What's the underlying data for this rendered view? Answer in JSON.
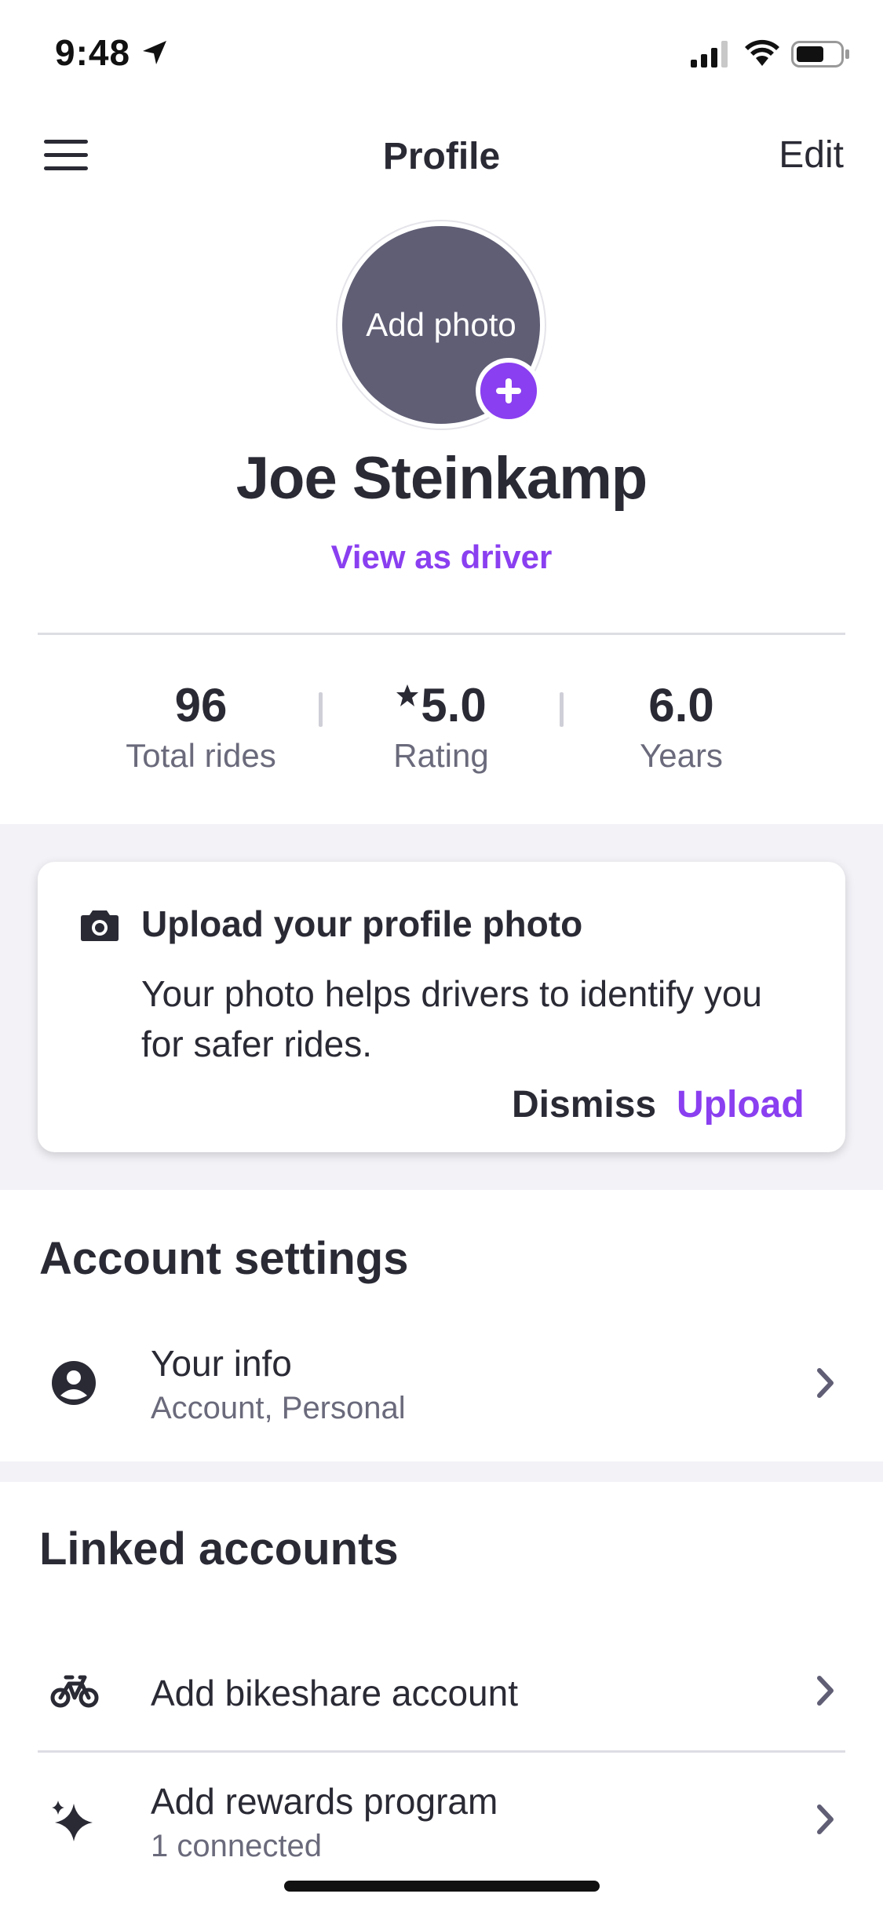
{
  "status_bar": {
    "time": "9:48"
  },
  "nav": {
    "title": "Profile",
    "edit_label": "Edit"
  },
  "profile": {
    "avatar_label": "Add photo",
    "name": "Joe Steinkamp",
    "view_as_driver": "View as driver"
  },
  "stats": [
    {
      "value": "96",
      "label": "Total rides"
    },
    {
      "value": "5.0",
      "label": "Rating",
      "icon": "star-icon"
    },
    {
      "value": "6.0",
      "label": "Years"
    }
  ],
  "upload_card": {
    "icon": "camera-icon",
    "title": "Upload your profile photo",
    "body": "Your photo helps drivers to identify you for safer rides.",
    "dismiss_label": "Dismiss",
    "upload_label": "Upload"
  },
  "account_settings": {
    "title": "Account settings",
    "items": [
      {
        "icon": "user-circle-icon",
        "title": "Your info",
        "subtitle": "Account, Personal"
      }
    ]
  },
  "linked_accounts": {
    "title": "Linked accounts",
    "items": [
      {
        "icon": "bicycle-icon",
        "title": "Add bikeshare account",
        "subtitle": ""
      },
      {
        "icon": "sparkle-icon",
        "title": "Add rewards program",
        "subtitle": "1 connected"
      }
    ]
  },
  "colors": {
    "accent": "#8a3ff0",
    "text": "#2a2a35",
    "muted": "#6a6a7c",
    "avatar_bg": "#5f5e75",
    "band_bg": "#f2f2f7"
  }
}
